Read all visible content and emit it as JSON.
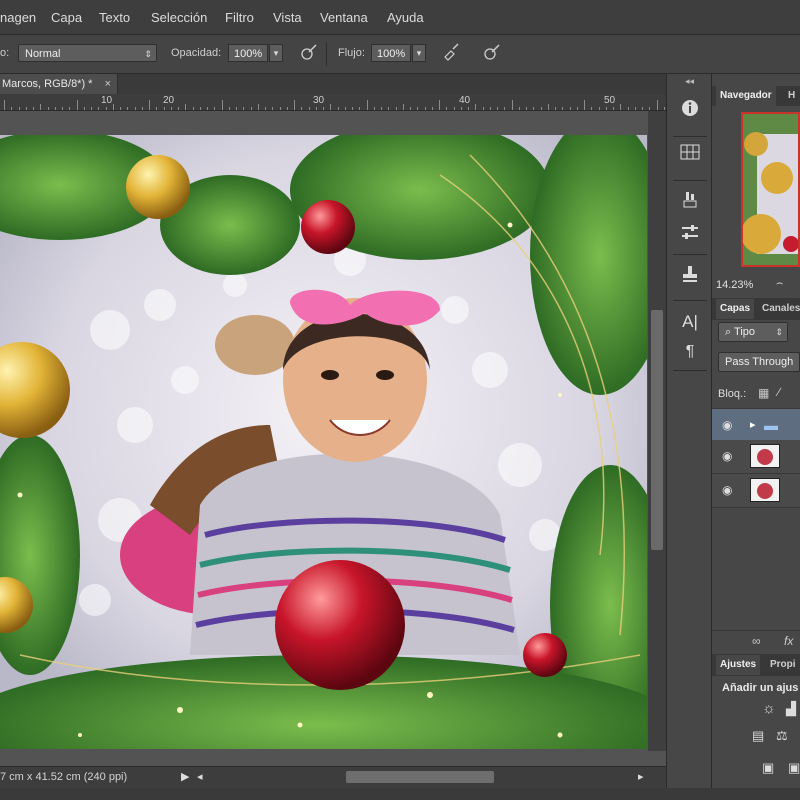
{
  "menu": {
    "items": [
      "nagen",
      "Capa",
      "Texto",
      "Selección",
      "Filtro",
      "Vista",
      "Ventana",
      "Ayuda"
    ]
  },
  "options": {
    "mode_label": "o:",
    "mode_value": "Normal",
    "opacity_label": "Opacidad:",
    "opacity_value": "100%",
    "flow_label": "Flujo:",
    "flow_value": "100%"
  },
  "document": {
    "tab_title": "Marcos, RGB/8*) *",
    "close": "×",
    "ruler_labels": [
      "10",
      "20",
      "30",
      "40",
      "50"
    ],
    "status_text": "7 cm x 41.52 cm (240 ppi)"
  },
  "right_panels": {
    "nav_tab": "Navegador",
    "nav_tab2": "H",
    "zoom": "14.23%",
    "layers_tab": "Capas",
    "channels_tab": "Canales",
    "filter_kind": "Tipo",
    "blend_mode": "Pass Through",
    "lock_label": "Bloq.:",
    "adjust_tab": "Ajustes",
    "props_tab": "Propi",
    "adjust_title": "Añadir un ajus"
  },
  "icons": {
    "tools": [
      "info-icon",
      "swatch-grid-icon",
      "brush-preset-icon",
      "sliders-icon",
      "clone-stamp-icon",
      "character-icon",
      "paragraph-icon"
    ]
  },
  "colors": {
    "panel_bg": "#474747",
    "accent_red": "#c8332a",
    "canvas_bg": "#535353"
  }
}
